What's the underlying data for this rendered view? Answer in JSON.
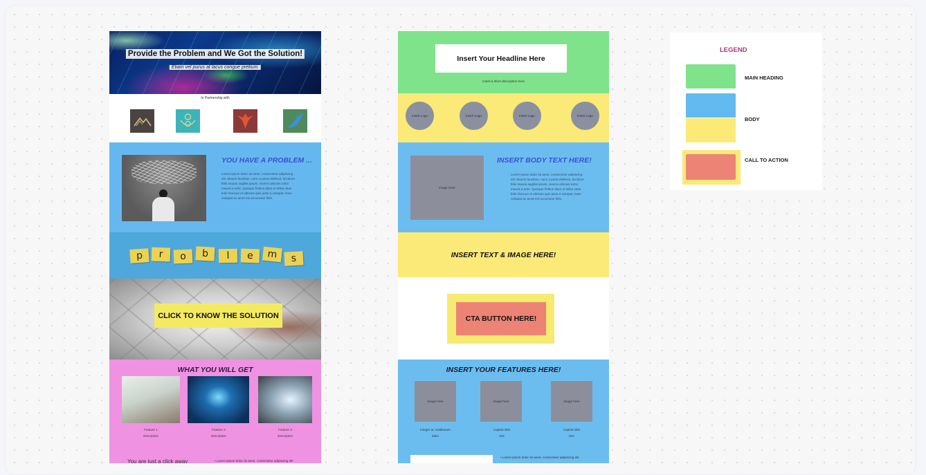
{
  "left_template": {
    "hero": {
      "title": "Provide the Problem and We Got the Solution!",
      "subtitle": "Etiam vel purus at lacus congue pretium."
    },
    "partners": {
      "label": "In Partnership with",
      "logos": [
        "mountain-logo",
        "lotus-logo",
        "phoenix-logo",
        "wave-logo"
      ]
    },
    "problem": {
      "title": "YOU HAVE A PROBLEM ...",
      "body": "Lorem ipsum dolor sit amet, consectetur adipiscing elit. Mauris faucibus, nunc a porta eleifend, tincidunt felis mauris sagittis ipsum, viverra ultricies tortor mauris a ante. Quisque finibus diam et tellus vitae felis rhoncus et ultricies quis justo a volutpat. Nam volutpat ac amet est accumsan felis."
    },
    "problems_tiles": [
      "p",
      "r",
      "o",
      "b",
      "l",
      "e",
      "m",
      "s"
    ],
    "cta_button": "CLICK TO KNOW THE SOLUTION",
    "what_you_get": {
      "title": "WHAT YOU WILL GET",
      "features": [
        {
          "name": "Feature 1",
          "desc": "description"
        },
        {
          "name": "Feature 2",
          "desc": "description"
        },
        {
          "name": "Feature 3",
          "desc": "description"
        }
      ],
      "bottom_left": "You are just a click away",
      "bottom_right": "• Lorem ipsum dolor sit amet, consectetur adipiscing elit"
    }
  },
  "middle_template": {
    "headline": "Insert Your Headline Here",
    "headline_sub": "Insert a short description here",
    "logos": [
      "Insert Logo",
      "Insert Logo",
      "Insert Logo",
      "Insert Logo"
    ],
    "body": {
      "image_label": "Image Here",
      "title": "INSERT BODY TEXT HERE!",
      "text": "Lorem ipsum dolor sit amet, consectetur adipiscing elit. Mauris faucibus, nunc a porta eleifend, tincidunt felis mauris sagittis ipsum, viverra ultricies tortor mauris a ante. Quisque finibus diam et tellus vitae felis rhoncus et ultricies quis justo a volutpat. Nam volutpat ac amet est accumsan felis."
    },
    "text_image": "INSERT TEXT & IMAGE HERE!",
    "cta_button": "CTA BUTTON HERE!",
    "features": {
      "title": "INSERT YOUR FEATURES HERE!",
      "items": [
        {
          "image_label": "Image here",
          "caption": "Integer ac vestibulum",
          "sub": "diam"
        },
        {
          "image_label": "Image here",
          "caption": "Caption title",
          "sub": "text"
        },
        {
          "image_label": "Image here",
          "caption": "Caption title",
          "sub": "text"
        }
      ],
      "bullet": "• Lorem ipsum dolor sit amet, consectetur adipiscing elit"
    }
  },
  "legend": {
    "title": "LEGEND",
    "items": [
      {
        "label": "MAIN HEADING",
        "color": "#7ee38b"
      },
      {
        "label": "BODY",
        "colors": [
          "#62baf1",
          "#fbe978"
        ]
      },
      {
        "label": "CALL TO ACTION",
        "color": "#ec8374",
        "border": "#fbe978"
      }
    ]
  }
}
